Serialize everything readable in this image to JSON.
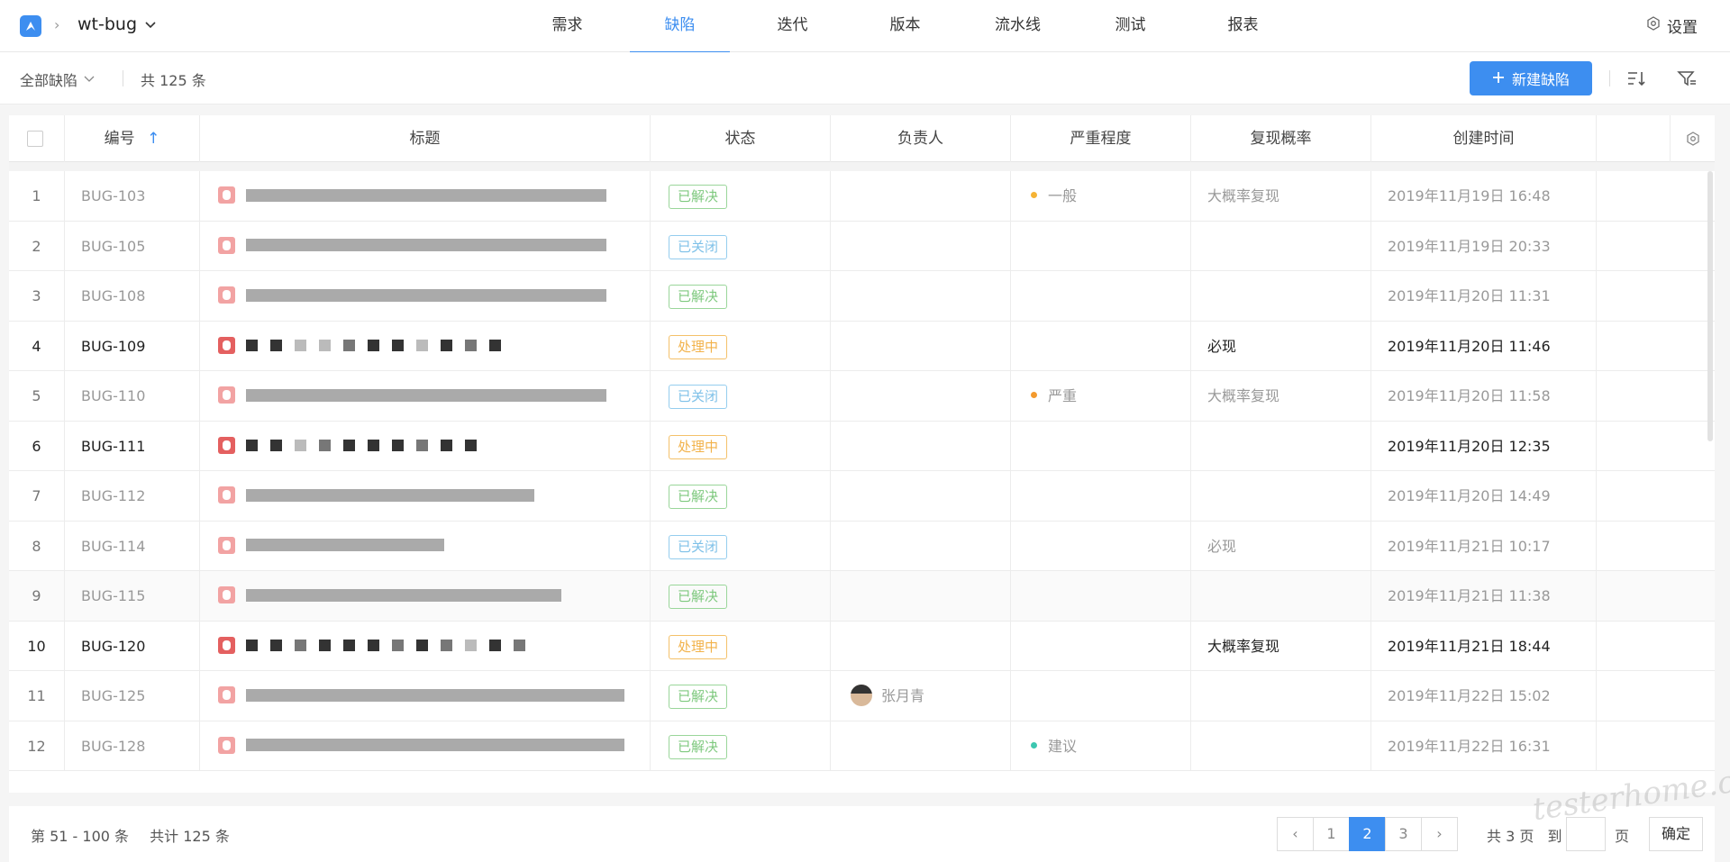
{
  "header": {
    "project_name": "wt-bug",
    "nav_tabs": [
      {
        "label": "需求",
        "active": false
      },
      {
        "label": "缺陷",
        "active": true
      },
      {
        "label": "迭代",
        "active": false
      },
      {
        "label": "版本",
        "active": false
      },
      {
        "label": "流水线",
        "active": false
      },
      {
        "label": "测试",
        "active": false
      },
      {
        "label": "报表",
        "active": false
      }
    ],
    "settings_label": "设置"
  },
  "toolbar": {
    "filter_label": "全部缺陷",
    "total_label": "共 125 条",
    "new_button_label": "新建缺陷"
  },
  "table": {
    "columns": [
      "编号",
      "标题",
      "状态",
      "负责人",
      "严重程度",
      "复现概率",
      "创建时间"
    ],
    "rows": [
      {
        "index": "1",
        "id": "BUG-103",
        "status": "已解决",
        "status_color": "green",
        "owner": "",
        "severity": "一般",
        "severity_color": "#f5b335",
        "repro": "大概率复现",
        "created": "2019年11月19日 16:48",
        "active": false
      },
      {
        "index": "2",
        "id": "BUG-105",
        "status": "已关闭",
        "status_color": "blue",
        "owner": "",
        "severity": "",
        "severity_color": "",
        "repro": "",
        "created": "2019年11月19日 20:33",
        "active": false
      },
      {
        "index": "3",
        "id": "BUG-108",
        "status": "已解决",
        "status_color": "green",
        "owner": "",
        "severity": "",
        "severity_color": "",
        "repro": "",
        "created": "2019年11月20日 11:31",
        "active": false
      },
      {
        "index": "4",
        "id": "BUG-109",
        "status": "处理中",
        "status_color": "orange",
        "owner": "",
        "severity": "",
        "severity_color": "",
        "repro": "必现",
        "created": "2019年11月20日 11:46",
        "active": true
      },
      {
        "index": "5",
        "id": "BUG-110",
        "status": "已关闭",
        "status_color": "blue",
        "owner": "",
        "severity": "严重",
        "severity_color": "#f39a2e",
        "repro": "大概率复现",
        "created": "2019年11月20日 11:58",
        "active": false
      },
      {
        "index": "6",
        "id": "BUG-111",
        "status": "处理中",
        "status_color": "orange",
        "owner": "",
        "severity": "",
        "severity_color": "",
        "repro": "",
        "created": "2019年11月20日 12:35",
        "active": true
      },
      {
        "index": "7",
        "id": "BUG-112",
        "status": "已解决",
        "status_color": "green",
        "owner": "",
        "severity": "",
        "severity_color": "",
        "repro": "",
        "created": "2019年11月20日 14:49",
        "active": false
      },
      {
        "index": "8",
        "id": "BUG-114",
        "status": "已关闭",
        "status_color": "blue",
        "owner": "",
        "severity": "",
        "severity_color": "",
        "repro": "必现",
        "created": "2019年11月21日 10:17",
        "active": false
      },
      {
        "index": "9",
        "id": "BUG-115",
        "status": "已解决",
        "status_color": "green",
        "owner": "",
        "severity": "",
        "severity_color": "",
        "repro": "",
        "created": "2019年11月21日 11:38",
        "active": false
      },
      {
        "index": "10",
        "id": "BUG-120",
        "status": "处理中",
        "status_color": "orange",
        "owner": "",
        "severity": "",
        "severity_color": "",
        "repro": "大概率复现",
        "created": "2019年11月21日 18:44",
        "active": true
      },
      {
        "index": "11",
        "id": "BUG-125",
        "status": "已解决",
        "status_color": "green",
        "owner": "张月青",
        "severity": "",
        "severity_color": "",
        "repro": "",
        "created": "2019年11月22日 15:02",
        "active": false
      },
      {
        "index": "12",
        "id": "BUG-128",
        "status": "已解决",
        "status_color": "green",
        "owner": "",
        "severity": "建议",
        "severity_color": "#3cc7b0",
        "repro": "",
        "created": "2019年11月22日 16:31",
        "active": false
      }
    ]
  },
  "footer": {
    "range_label": "第 51 - 100 条",
    "total_label": "共计 125 条",
    "pages": [
      "1",
      "2",
      "3"
    ],
    "current_page": "2",
    "pages_total_label": "共 3 页",
    "jump_prefix": "到",
    "jump_suffix": "页",
    "confirm_label": "确定"
  },
  "watermark": "testerhome.com"
}
